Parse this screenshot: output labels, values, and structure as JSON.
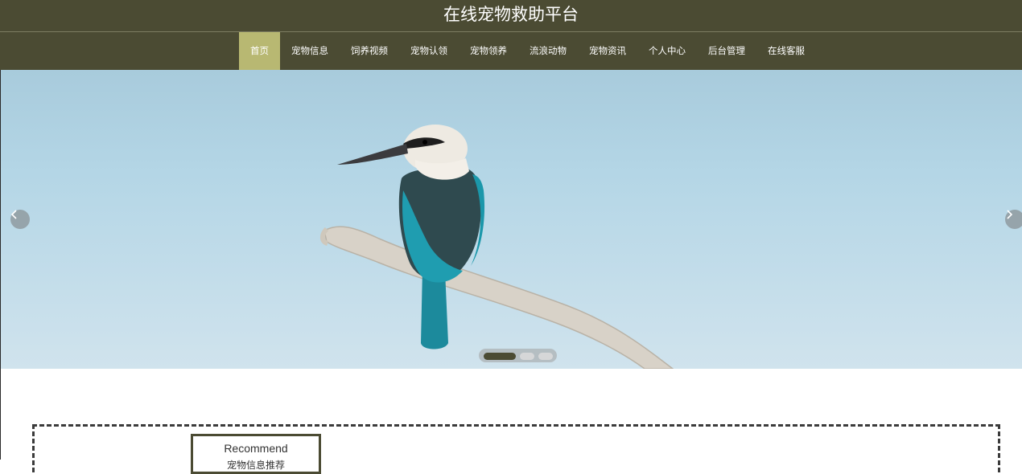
{
  "header": {
    "title": "在线宠物救助平台",
    "nav": [
      {
        "label": "首页",
        "active": true
      },
      {
        "label": "宠物信息",
        "active": false
      },
      {
        "label": "饲养视频",
        "active": false
      },
      {
        "label": "宠物认领",
        "active": false
      },
      {
        "label": "宠物领养",
        "active": false
      },
      {
        "label": "流浪动物",
        "active": false
      },
      {
        "label": "宠物资讯",
        "active": false
      },
      {
        "label": "个人中心",
        "active": false
      },
      {
        "label": "后台管理",
        "active": false
      },
      {
        "label": "在线客服",
        "active": false
      }
    ]
  },
  "carousel": {
    "prev_icon": "chevron-left-icon",
    "next_icon": "chevron-right-icon",
    "slide_count": 3,
    "active_slide": 1,
    "image": "kingfisher-on-branch"
  },
  "recommend": {
    "title_en": "Recommend",
    "title_cn": "宠物信息推荐"
  },
  "colors": {
    "header_bg": "#4b4b33",
    "nav_active_bg": "#b8b872",
    "sky": "#b4d6e6"
  }
}
